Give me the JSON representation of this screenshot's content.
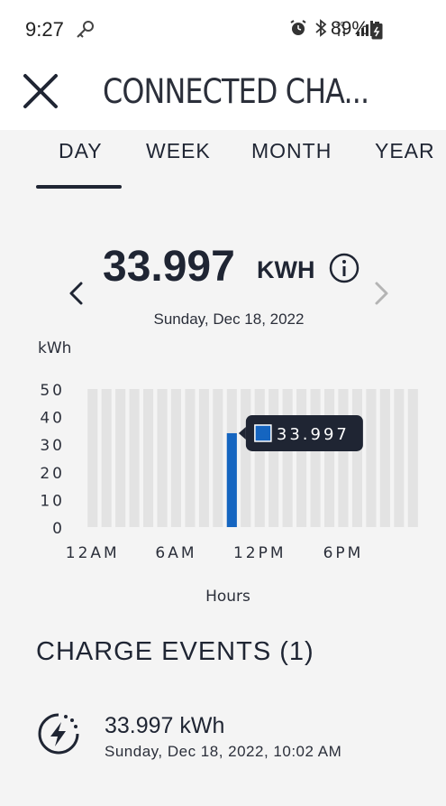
{
  "status_bar": {
    "time": "9:27",
    "battery": "89%",
    "icons": [
      "wrench-key-icon",
      "alarm-icon",
      "bluetooth-icon",
      "4g-data-icon",
      "signal-icon",
      "battery-icon"
    ]
  },
  "header": {
    "title": "CONNECTED CHA...",
    "close_icon": "close-icon"
  },
  "tabs": {
    "selected": "DAY",
    "items": [
      "DAY",
      "WEEK",
      "MONTH",
      "YEAR"
    ]
  },
  "summary": {
    "value": "33.997",
    "unit": "KWH",
    "date": "Sunday, Dec 18, 2022"
  },
  "chart_data": {
    "type": "bar",
    "ylabel": "kWh",
    "xlabel": "Hours",
    "ylim": [
      0,
      50
    ],
    "yticks": [
      "50",
      "40",
      "30",
      "20",
      "10",
      "0"
    ],
    "xticks": [
      "12AM",
      "6AM",
      "12PM",
      "6PM"
    ],
    "categories": [
      "0",
      "1",
      "2",
      "3",
      "4",
      "5",
      "6",
      "7",
      "8",
      "9",
      "10",
      "11",
      "12",
      "13",
      "14",
      "15",
      "16",
      "17",
      "18",
      "19",
      "20",
      "21",
      "22",
      "23"
    ],
    "values": [
      0,
      0,
      0,
      0,
      0,
      0,
      0,
      0,
      0,
      0,
      33.997,
      0,
      0,
      0,
      0,
      0,
      0,
      0,
      0,
      0,
      0,
      0,
      0,
      0
    ],
    "tooltip": "33.997",
    "colors": {
      "bar": "#1565c0",
      "track": "#e3e3e3",
      "tooltip_bg": "#1f2533"
    }
  },
  "events": {
    "title": "CHARGE EVENTS (1)",
    "items": [
      {
        "energy": "33.997 kWh",
        "time": "Sunday, Dec 18, 2022, 10:02 AM",
        "icon": "charge-bolt-icon"
      }
    ]
  }
}
